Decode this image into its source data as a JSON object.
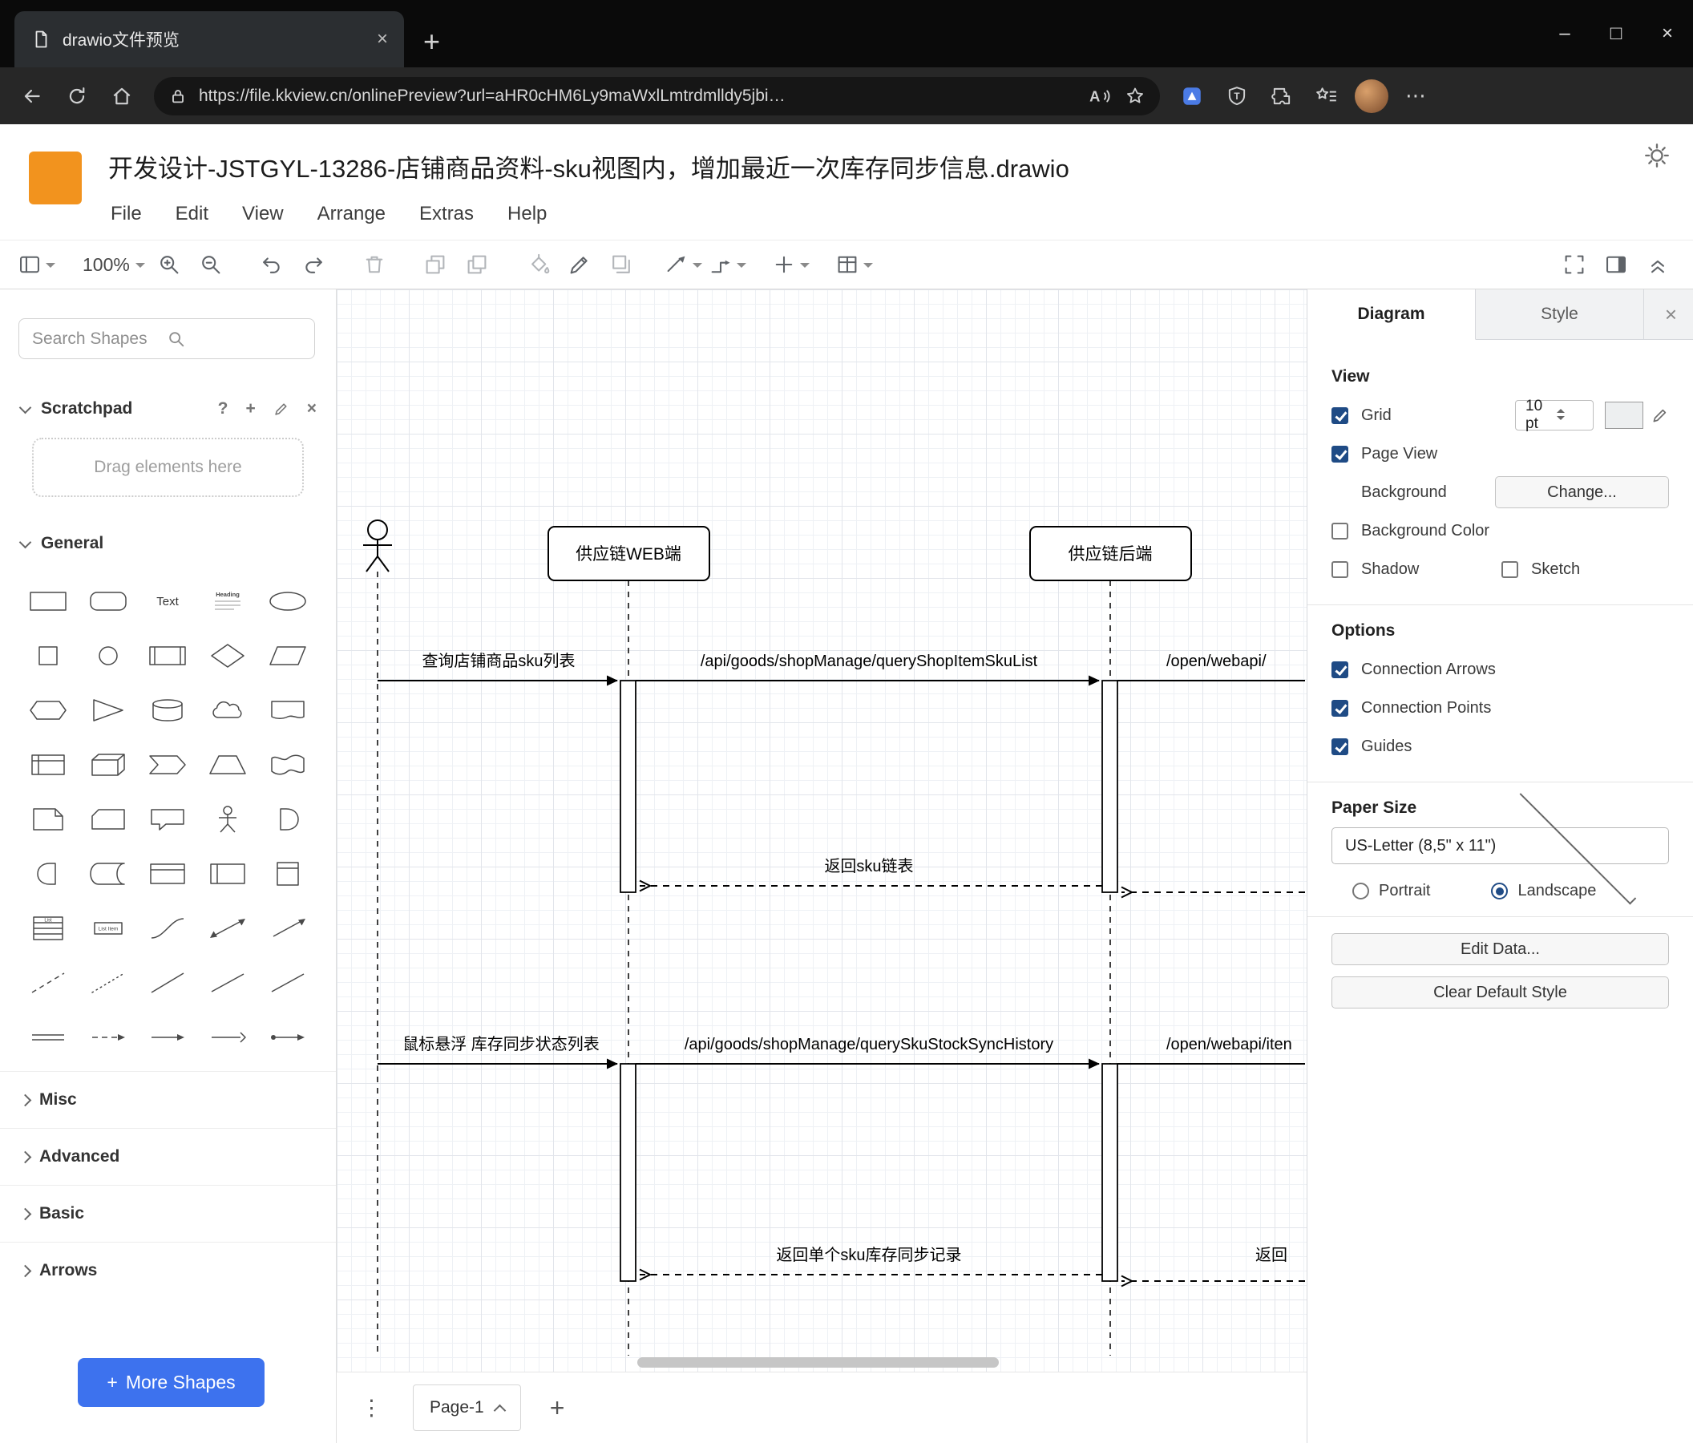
{
  "icons": {
    "plus": "+",
    "minimize": "–",
    "maximize": "□",
    "close": "×",
    "overflow": "⋯",
    "page_menu": "⋮",
    "help": "?"
  },
  "browser": {
    "tab_title": "drawio文件预览",
    "url": "https://file.kkview.cn/onlinePreview?url=aHR0cHM6Ly9maWxlLmtrdmlldy5jbi…"
  },
  "app": {
    "title": "开发设计-JSTGYL-13286-店铺商品资料-sku视图内，增加最近一次库存同步信息.drawio",
    "menus": [
      "File",
      "Edit",
      "View",
      "Arrange",
      "Extras",
      "Help"
    ],
    "toolbar": {
      "zoom": "100%",
      "left_buttons": [
        "view",
        "zoom",
        "zoom-in",
        "zoom-out",
        "undo",
        "redo",
        "delete",
        "to-front",
        "to-back",
        "fill-color",
        "line-color",
        "shadow",
        "connection",
        "waypoints",
        "insert",
        "table"
      ],
      "right_buttons": [
        "fullscreen",
        "format-panel",
        "collapse"
      ]
    }
  },
  "sidebar": {
    "search_placeholder": "Search Shapes",
    "scratchpad": {
      "title": "Scratchpad",
      "hint": "Drag elements here"
    },
    "general_label": "General",
    "sections": [
      "Misc",
      "Advanced",
      "Basic",
      "Arrows"
    ],
    "shapes": [
      "rectangle",
      "rounded-rectangle",
      "text",
      "textbox",
      "ellipse",
      "square",
      "circle",
      "process",
      "diamond",
      "parallelogram",
      "hexagon",
      "triangle",
      "cylinder",
      "cloud",
      "document",
      "internal-storage",
      "cube",
      "step",
      "trapezoid",
      "tape",
      "note",
      "card",
      "callout",
      "actor",
      "or",
      "and",
      "data-storage",
      "container",
      "horizontal-container",
      "vertical-container",
      "list",
      "list-item",
      "curve",
      "bidirectional-arrow",
      "arrow",
      "dashed-line",
      "dotted-line",
      "line",
      "bidirectional-connector",
      "directional-connector",
      "link",
      "dashed-edge",
      "edge",
      "simple-arrow",
      "endpoint-arrow"
    ],
    "shape_labels": {
      "text": "Text",
      "textbox": "Heading",
      "list": "List",
      "list_item": "List Item"
    },
    "more_shapes": "More Shapes"
  },
  "canvas": {
    "page_tab": "Page-1"
  },
  "diagram": {
    "participants": [
      {
        "type": "actor",
        "label": ""
      },
      {
        "type": "lifeline",
        "label": "供应链WEB端"
      },
      {
        "type": "lifeline",
        "label": "供应链后端"
      }
    ],
    "messages": [
      {
        "label": "查询店铺商品sku列表",
        "style": "solid"
      },
      {
        "label": "/api/goods/shopManage/queryShopItemSkuList",
        "style": "solid"
      },
      {
        "label": "/open/webapi/",
        "style": "solid"
      },
      {
        "label": "返回sku链表",
        "style": "dashed"
      },
      {
        "label": "鼠标悬浮 库存同步状态列表",
        "style": "solid"
      },
      {
        "label": "/api/goods/shopManage/querySkuStockSyncHistory",
        "style": "solid"
      },
      {
        "label": "/open/webapi/iten",
        "style": "solid"
      },
      {
        "label": "返回单个sku库存同步记录",
        "style": "dashed"
      },
      {
        "label": "返回",
        "style": "dashed"
      }
    ]
  },
  "format_panel": {
    "tabs": [
      "Diagram",
      "Style"
    ],
    "active_tab": "Diagram",
    "view": {
      "heading": "View",
      "grid": "Grid",
      "grid_size": "10 pt",
      "page_view": "Page View",
      "background": "Background",
      "change_button": "Change...",
      "background_color": "Background Color",
      "shadow": "Shadow",
      "sketch": "Sketch"
    },
    "options": {
      "heading": "Options",
      "connection_arrows": "Connection Arrows",
      "connection_points": "Connection Points",
      "guides": "Guides"
    },
    "paper": {
      "heading": "Paper Size",
      "size": "US-Letter (8,5\" x 11\")",
      "portrait": "Portrait",
      "landscape": "Landscape"
    },
    "edit_data": "Edit Data...",
    "clear_default_style": "Clear Default Style"
  },
  "colors": {
    "accent_orange": "#F2931E",
    "more_shapes_blue": "#3D72EE",
    "check_blue": "#1F4B85"
  }
}
